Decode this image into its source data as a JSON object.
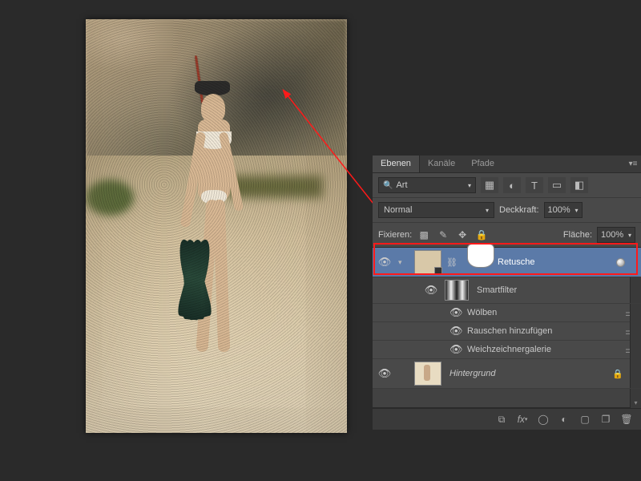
{
  "panel": {
    "tabs": [
      "Ebenen",
      "Kanäle",
      "Pfade"
    ],
    "active_tab": 0,
    "filter_label": "Art",
    "blend_mode": "Normal",
    "opacity_label": "Deckkraft:",
    "opacity_value": "100%",
    "lock_label": "Fixieren:",
    "fill_label": "Fläche:",
    "fill_value": "100%"
  },
  "layers": {
    "retouch": {
      "name": "Retusche"
    },
    "smartfilters_label": "Smartfilter",
    "filters": [
      {
        "name": "Wölben"
      },
      {
        "name": "Rauschen hinzufügen"
      },
      {
        "name": "Weichzeichnergalerie"
      }
    ],
    "background": {
      "name": "Hintergrund"
    }
  },
  "annotation": {
    "arrow_color": "#ff1a1a"
  }
}
